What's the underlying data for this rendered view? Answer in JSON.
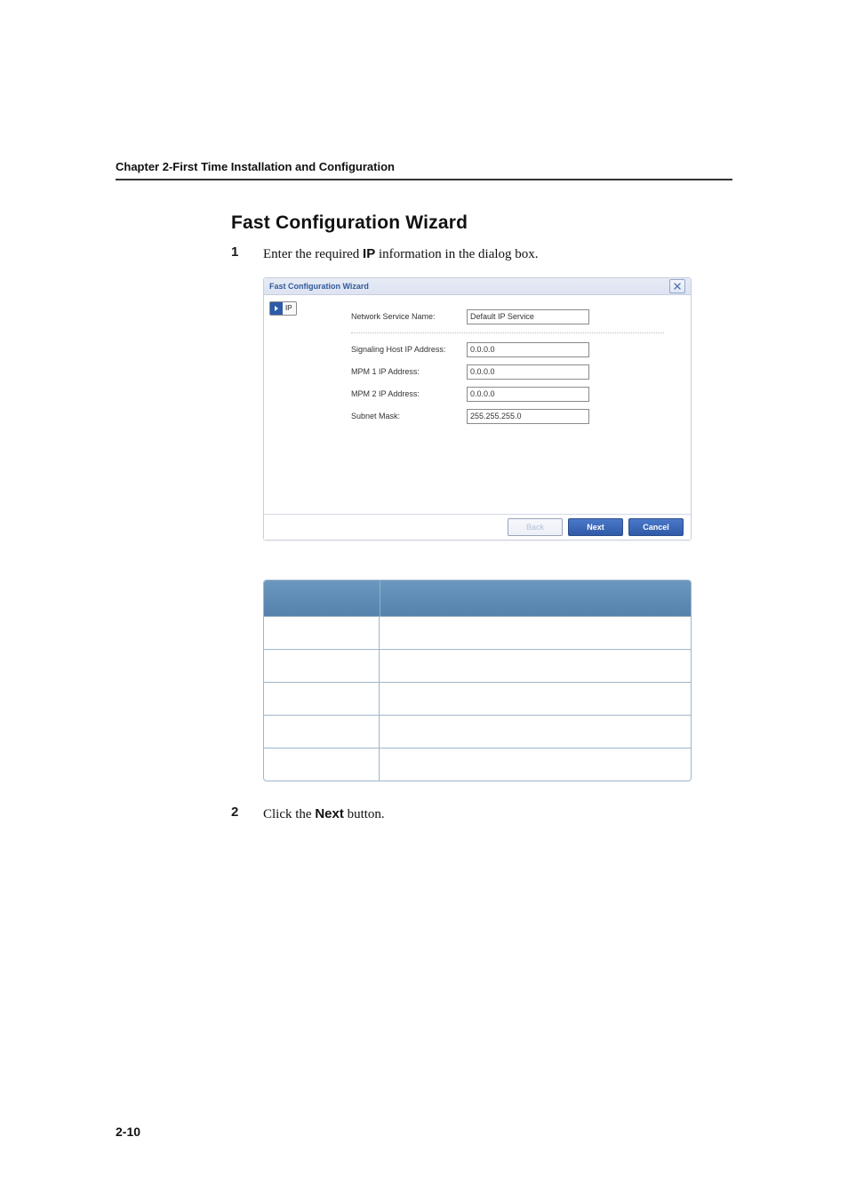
{
  "chapter_header": "Chapter 2-First Time Installation and Configuration",
  "section_title": "Fast Configuration Wizard",
  "steps": [
    {
      "num": "1",
      "pre": "Enter the required ",
      "bold": "IP",
      "post": " information in the dialog box."
    },
    {
      "num": "2",
      "pre": "Click the ",
      "bold": "Next",
      "post": " button."
    }
  ],
  "wizard": {
    "title": "Fast Configuration Wizard",
    "side_label": "IP",
    "fields": {
      "network_service_name": {
        "label": "Network Service Name:",
        "value": "Default IP Service"
      },
      "signaling_host": {
        "label": "Signaling Host IP Address:",
        "value": "0.0.0.0"
      },
      "mpm1": {
        "label": "MPM 1 IP Address:",
        "value": "0.0.0.0"
      },
      "mpm2": {
        "label": "MPM 2 IP Address:",
        "value": "0.0.0.0"
      },
      "subnet": {
        "label": "Subnet Mask:",
        "value": "255.255.255.0"
      }
    },
    "buttons": {
      "back": "Back",
      "next": "Next",
      "cancel": "Cancel"
    }
  },
  "page_number": "2-10"
}
